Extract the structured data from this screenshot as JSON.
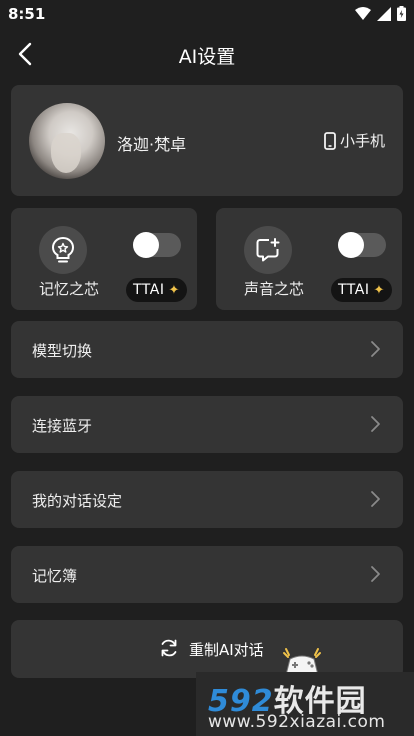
{
  "status_bar": {
    "time": "8:51"
  },
  "header": {
    "title": "AI设置"
  },
  "profile": {
    "name": "洛迦·梵卓",
    "device": "小手机"
  },
  "features": [
    {
      "label": "记忆之芯",
      "badge": "TTAI",
      "enabled": false
    },
    {
      "label": "声音之芯",
      "badge": "TTAI",
      "enabled": false
    }
  ],
  "menu": [
    {
      "label": "模型切换"
    },
    {
      "label": "连接蓝牙"
    },
    {
      "label": "我的对话设定"
    },
    {
      "label": "记忆簿"
    }
  ],
  "reset": {
    "label": "重制AI对话"
  },
  "watermark": {
    "logo_num": "592",
    "logo_cn": "软件园",
    "url": "www.592xiazai.com"
  },
  "colors": {
    "background": "#1f1f1f",
    "card": "#343434",
    "badge_star": "#f0c24a",
    "watermark_blue": "#2f8bd8"
  }
}
